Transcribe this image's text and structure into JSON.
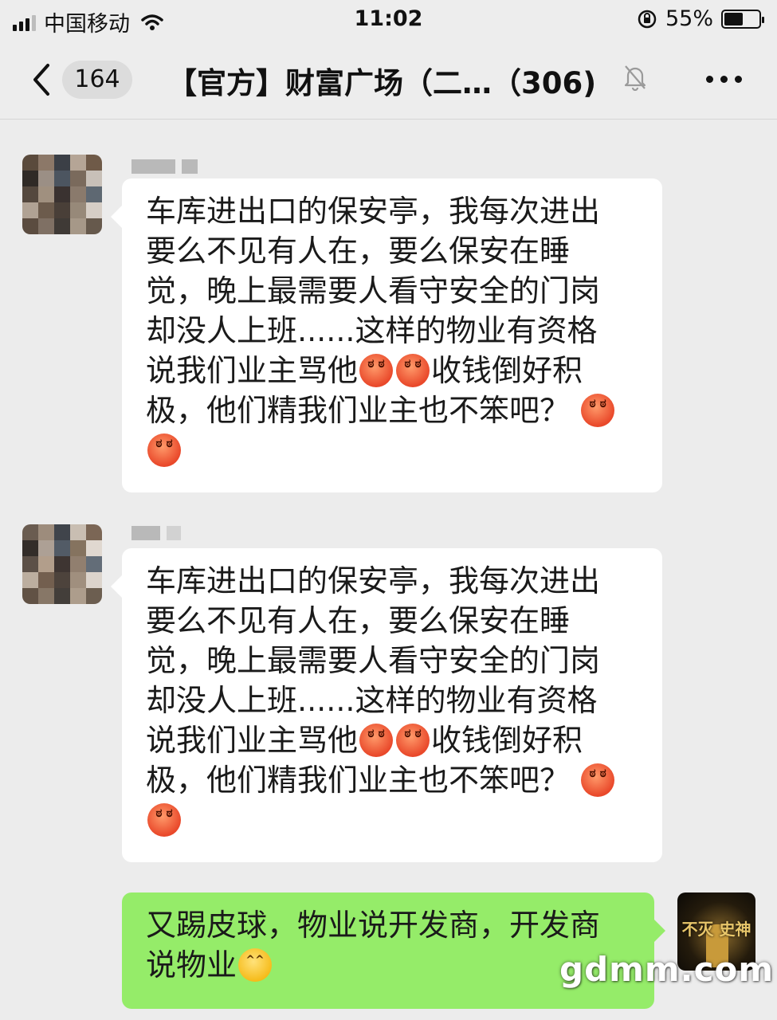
{
  "status_bar": {
    "carrier": "中国移动",
    "time": "11:02",
    "battery": "55%",
    "battery_level": 0.55
  },
  "nav": {
    "back_icon": "chevron-left-icon",
    "unread_count": "164",
    "title": "【官方】财富广场（二…（306)",
    "mute_icon": "bell-off-icon",
    "more_icon": "ellipsis-icon"
  },
  "messages": [
    {
      "side": "left",
      "lines": [
        "车库进出口的保安亭，我每次进出",
        "要么不见有人在，要么保安在睡",
        "觉，晚上最需要人看守安全的门岗",
        "却没人上班......这样的物业有资格",
        "说我们业主骂他",
        "收钱倒好积",
        "极，他们精我们业主也不笨吧？"
      ]
    },
    {
      "side": "left",
      "lines": [
        "车库进出口的保安亭，我每次进出",
        "要么不见有人在，要么保安在睡",
        "觉，晚上最需要人看守安全的门岗",
        "却没人上班......这样的物业有资格",
        "说我们业主骂他",
        "收钱倒好积",
        "极，他们精我们业主也不笨吧？"
      ]
    },
    {
      "side": "right",
      "lines": [
        "又踢皮球，物业说开发商，开发商",
        "说物业"
      ],
      "avatar_caption": "不灭 史神"
    }
  ],
  "emoji": {
    "angry": "angry-face-emoji",
    "laugh": "laughing-tears-emoji"
  },
  "watermark": "gdmm.com"
}
